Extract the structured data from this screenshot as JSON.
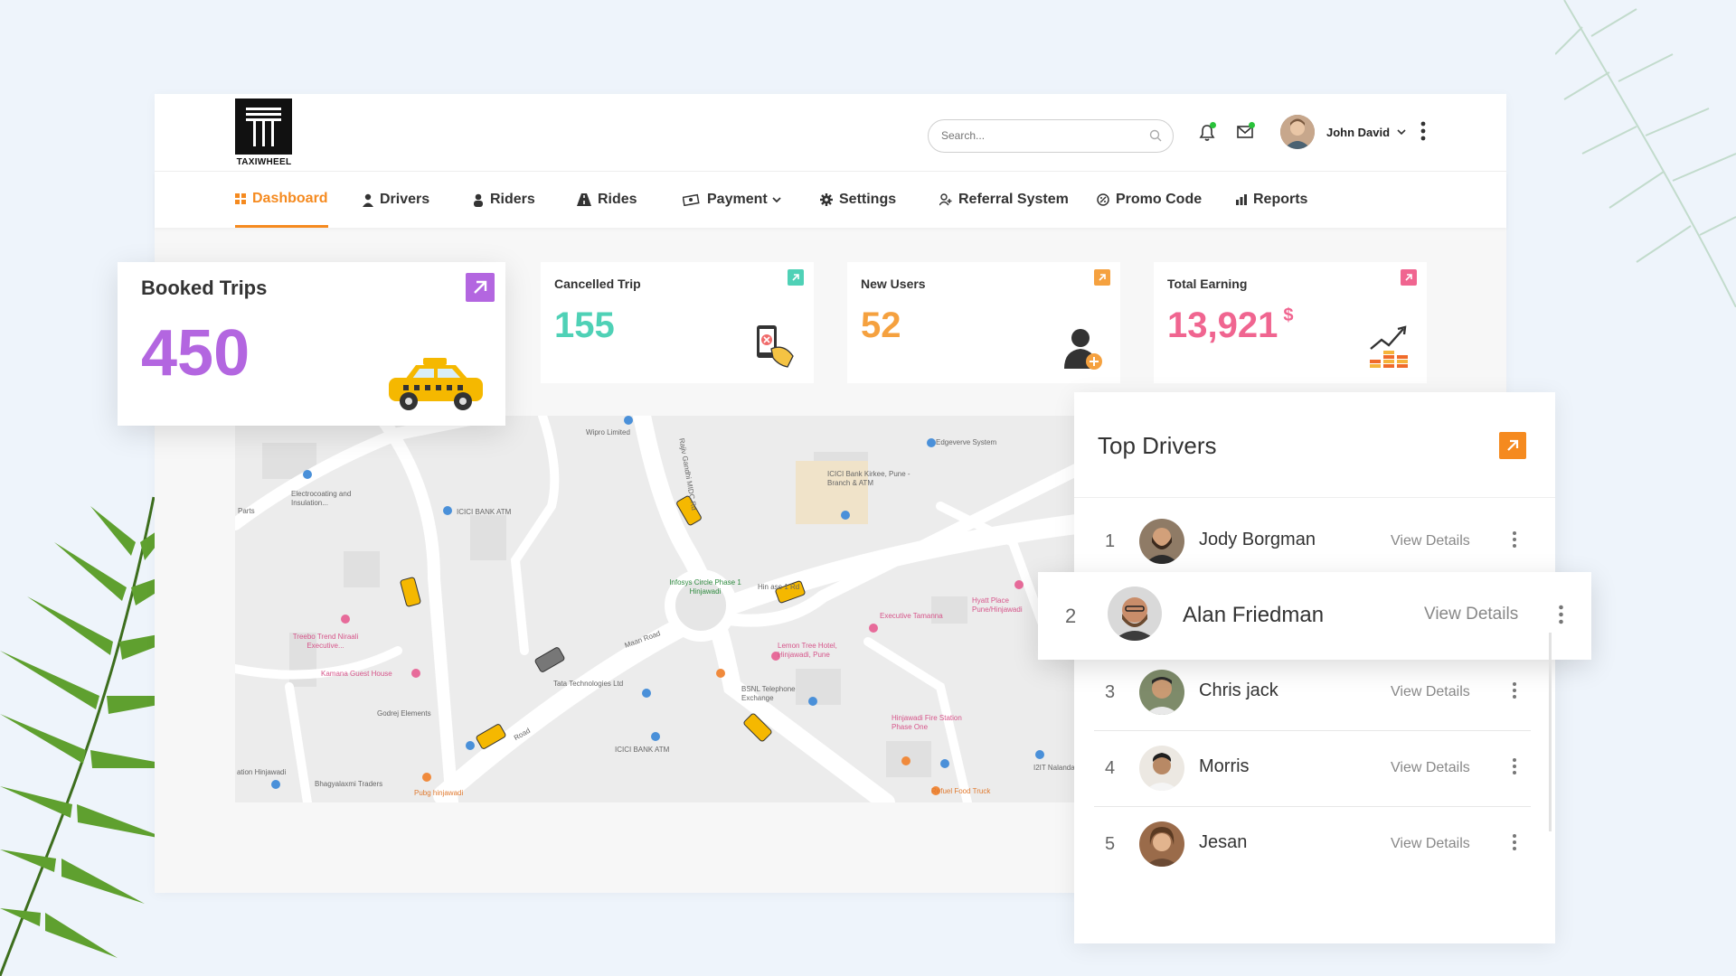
{
  "brand": {
    "name": "TAXIWHEEL"
  },
  "search": {
    "placeholder": "Search..."
  },
  "user": {
    "name": "John David"
  },
  "nav": [
    {
      "label": "Dashboard",
      "icon": "grid-icon",
      "active": true
    },
    {
      "label": "Drivers",
      "icon": "driver-icon"
    },
    {
      "label": "Riders",
      "icon": "person-icon"
    },
    {
      "label": "Rides",
      "icon": "road-icon"
    },
    {
      "label": "Payment",
      "icon": "cash-icon",
      "dropdown": true
    },
    {
      "label": "Settings",
      "icon": "gear-icon"
    },
    {
      "label": "Referral System",
      "icon": "referral-icon"
    },
    {
      "label": "Promo Code",
      "icon": "promo-icon"
    },
    {
      "label": "Reports",
      "icon": "bar-chart-icon"
    }
  ],
  "stats": {
    "booked": {
      "label": "Booked Trips",
      "value": "450",
      "color": "#b366e0",
      "icon": "taxi-icon"
    },
    "cancelled": {
      "label": "Cancelled Trip",
      "value": "155",
      "color": "#4fd1b6",
      "icon": "phone-cancel-icon"
    },
    "new_users": {
      "label": "New Users",
      "value": "52",
      "color": "#f5a13f",
      "icon": "add-user-icon"
    },
    "earning": {
      "label": "Total Earning",
      "value": "13,921",
      "unit": "$",
      "color": "#f06590",
      "icon": "growth-coins-icon"
    }
  },
  "map": {
    "labels": {
      "wipro": "Wipro Limited",
      "edgeverve": "Edgeverve System",
      "icici_kirkee": "ICICI Bank Kirkee, Pune - Branch & ATM",
      "electro": "Electrocoating and Insulation...",
      "parts": "Parts",
      "icici_atm1": "ICICI BANK ATM",
      "infosys": "Infosys Circle Phase 1 Hinjawadi",
      "phase1": "Hin  ase 1 Rd",
      "executive": "Executive Tamanna",
      "hyatt": "Hyatt Place Pune/Hinjawadi",
      "treebo": "Treebo Trend Niraali Executive...",
      "lemon": "Lemon Tree Hotel, Hinjawadi, Pune",
      "maan": "Maan Road",
      "kamana": "Kamana Guest House",
      "tata": "Tata Technologies Ltd",
      "bsnl": "BSNL Telephone Exchange",
      "godrej": "Godrej Elements",
      "icici_atm2": "ICICI BANK ATM",
      "fire": "Hinjawadi Fire Station Phase One",
      "hinjawadi": "ation Hinjawadi",
      "bhagyalaxmi": "Bhagyalaxmi Traders",
      "pubg": "Pubg hinjawadi",
      "refuel": "Refuel Food Truck",
      "i2it": "I2IT Nalanda",
      "road": "Road",
      "gandhi": "Rajiv Gandhi MIDC Rd"
    }
  },
  "top_drivers": {
    "title": "Top Drivers",
    "rows": [
      {
        "rank": "1",
        "name": "Jody Borgman",
        "action": "View Details"
      },
      {
        "rank": "2",
        "name": "Alan Friedman",
        "action": "View Details"
      },
      {
        "rank": "3",
        "name": "Chris jack",
        "action": "View Details"
      },
      {
        "rank": "4",
        "name": "Morris",
        "action": "View Details"
      },
      {
        "rank": "5",
        "name": "Jesan",
        "action": "View Details"
      }
    ]
  },
  "colors": {
    "accent": "#f58a1f",
    "notification": "#29c23a"
  }
}
